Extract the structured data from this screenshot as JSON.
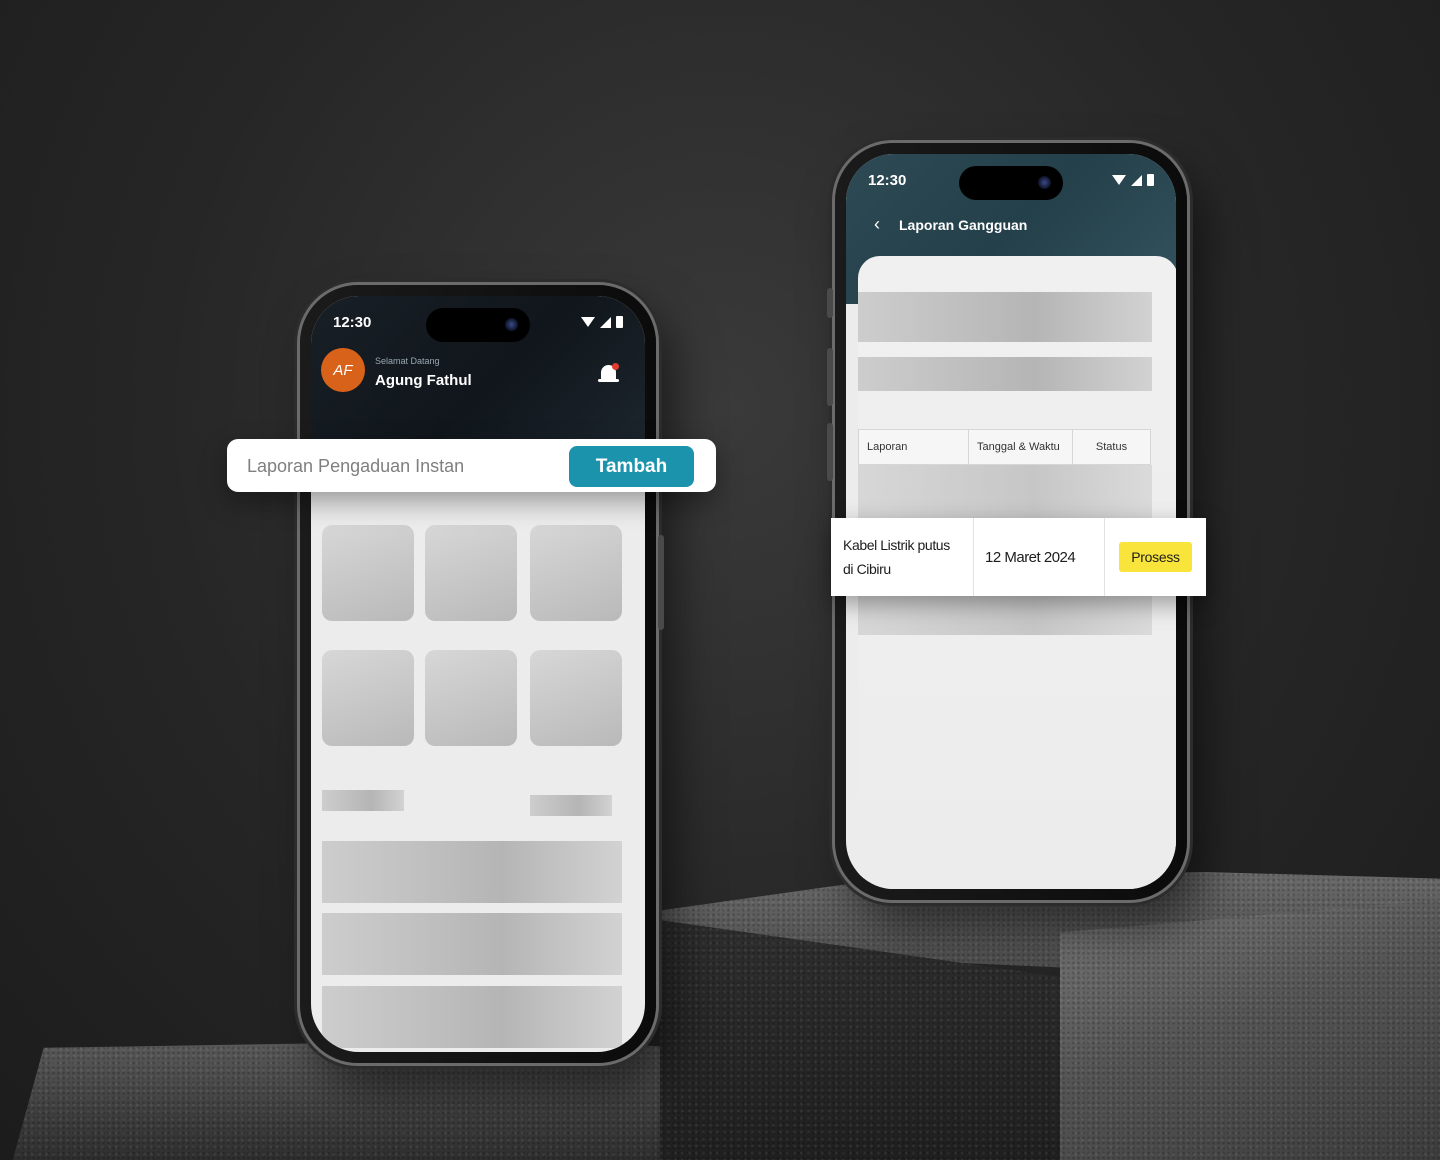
{
  "status_bar": {
    "time": "12:30"
  },
  "home_screen": {
    "avatar_initials": "AF",
    "greeting": "Selamat Datang",
    "user_name": "Agung Fathul"
  },
  "quick_report": {
    "placeholder": "Laporan Pengaduan Instan",
    "add_label": "Tambah",
    "button_color": "#1c93ad"
  },
  "report_screen": {
    "title": "Laporan Gangguan",
    "table_headers": [
      "Laporan",
      "Tanggal & Waktu",
      "Status"
    ]
  },
  "report_row": {
    "report_line1": "Kabel Listrik putus",
    "report_line2": "di Cibiru",
    "date": "12 Maret 2024",
    "status": "Prosess",
    "status_color": "#f8e43a"
  },
  "icons": [
    "wifi-icon",
    "signal-icon",
    "battery-icon",
    "bell-icon",
    "back-icon",
    "notification-dot-icon"
  ]
}
